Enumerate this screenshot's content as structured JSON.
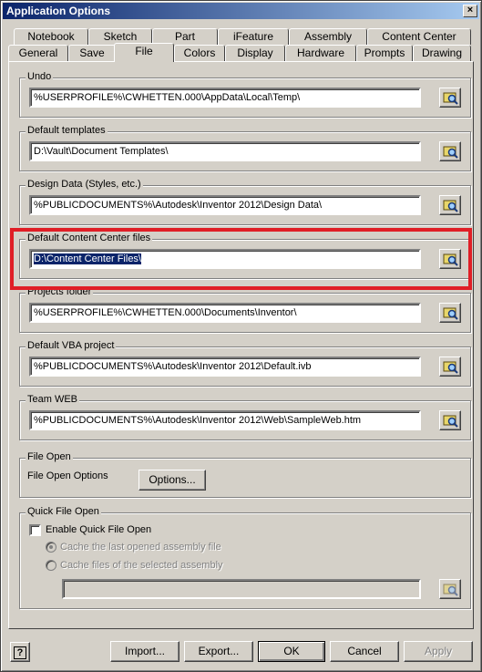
{
  "window": {
    "title": "Application Options",
    "close_glyph": "×"
  },
  "tabs_row1": [
    {
      "label": "Notebook"
    },
    {
      "label": "Sketch"
    },
    {
      "label": "Part"
    },
    {
      "label": "iFeature"
    },
    {
      "label": "Assembly"
    },
    {
      "label": "Content Center"
    }
  ],
  "tabs_row2": [
    {
      "label": "General"
    },
    {
      "label": "Save"
    },
    {
      "label": "File",
      "active": true
    },
    {
      "label": "Colors"
    },
    {
      "label": "Display"
    },
    {
      "label": "Hardware"
    },
    {
      "label": "Prompts"
    },
    {
      "label": "Drawing"
    }
  ],
  "groups": {
    "undo": {
      "label": "Undo",
      "value": "%USERPROFILE%\\CWHETTEN.000\\AppData\\Local\\Temp\\"
    },
    "templates": {
      "label": "Default templates",
      "value": "D:\\Vault\\Document Templates\\"
    },
    "design_data": {
      "label": "Design Data (Styles, etc.)",
      "value": "%PUBLICDOCUMENTS%\\Autodesk\\Inventor 2012\\Design Data\\"
    },
    "content_center": {
      "label": "Default Content Center files",
      "value": "D:\\Content Center Files\\"
    },
    "projects": {
      "label": "Projects folder",
      "value": "%USERPROFILE%\\CWHETTEN.000\\Documents\\Inventor\\"
    },
    "vba": {
      "label": "Default VBA project",
      "value": "%PUBLICDOCUMENTS%\\Autodesk\\Inventor 2012\\Default.ivb"
    },
    "team_web": {
      "label": "Team WEB",
      "value": "%PUBLICDOCUMENTS%\\Autodesk\\Inventor 2012\\Web\\SampleWeb.htm"
    },
    "file_open": {
      "label": "File Open",
      "options_label": "File Open Options",
      "button": "Options..."
    },
    "quick_open": {
      "label": "Quick File Open",
      "enable_label": "Enable Quick File Open",
      "enable_checked": false,
      "radio1": "Cache the last opened assembly file",
      "radio2": "Cache files of the selected assembly",
      "path_value": ""
    }
  },
  "footer": {
    "help_glyph": "?",
    "import": "Import...",
    "export": "Export...",
    "ok": "OK",
    "cancel": "Cancel",
    "apply": "Apply"
  },
  "colors": {
    "highlight": "#e01e26",
    "selection": "#0a246a",
    "title_start": "#0a246a"
  }
}
